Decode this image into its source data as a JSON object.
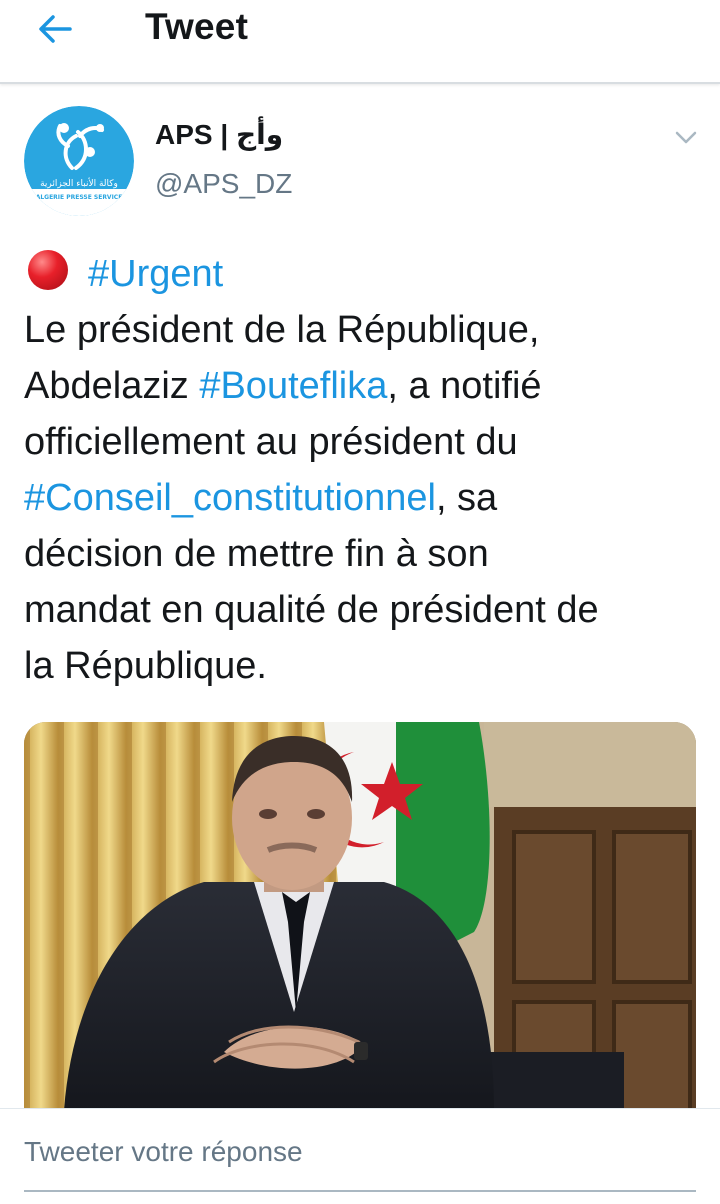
{
  "header": {
    "title": "Tweet",
    "back_icon": "arrow-left-icon"
  },
  "tweet": {
    "author": {
      "name": "APS | وأج",
      "handle": "@APS_DZ",
      "avatar_text": "وكالة الأنباء الجزائرية",
      "avatar_subtext": "ALGERIE PRESSE SERVICE"
    },
    "text": {
      "urgent_tag": "#Urgent",
      "l1": "Le président de la République,",
      "l2_pre": "Abdelaziz ",
      "l2_tag": "#Bouteflika",
      "l2_post": ", a notifié",
      "l3": "officiellement au président du",
      "l4_tag": "#Conseil_constitutionnel",
      "l4_post": ", sa",
      "l5": "décision de mettre fin à son",
      "l6": "mandat en qualité de président de",
      "l7": "la République."
    }
  },
  "reply": {
    "placeholder": "Tweeter votre réponse"
  },
  "colors": {
    "accent": "#1b95e0",
    "text": "#14171a",
    "secondary": "#657786"
  }
}
